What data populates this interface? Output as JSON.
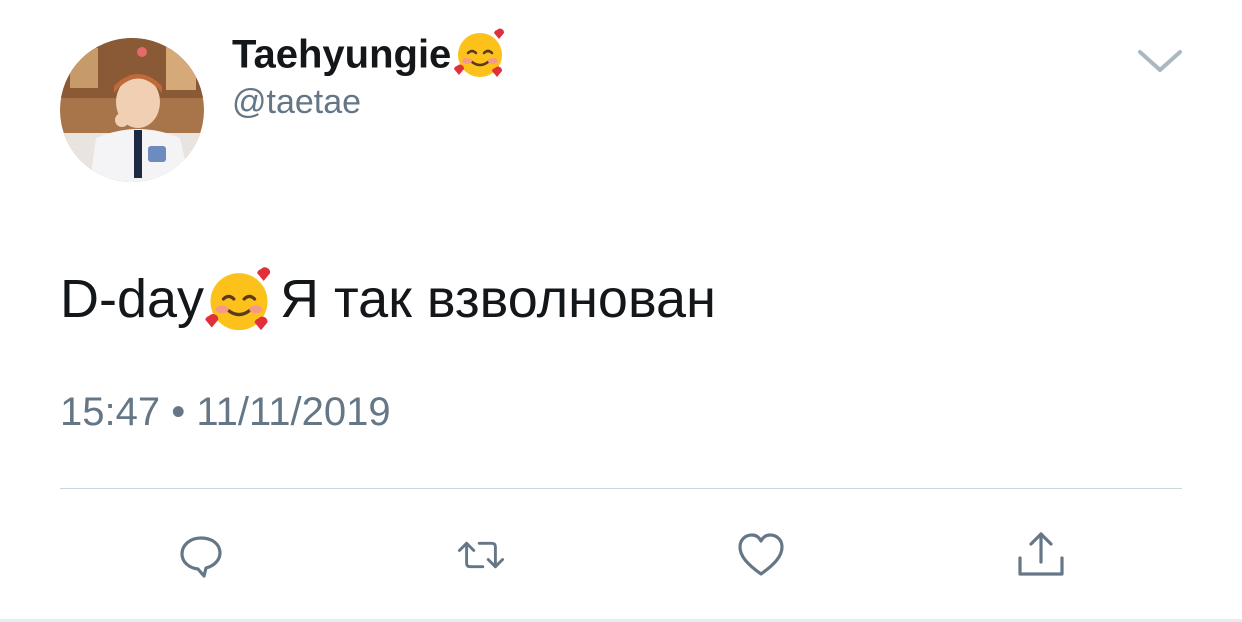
{
  "tweet": {
    "author": {
      "display_name": "Taehyungie",
      "display_name_emoji": "smiling-face-with-hearts",
      "handle": "@taetae",
      "avatar": "avatar-photo"
    },
    "menu_icon": "chevron-down-icon",
    "text": {
      "prefix": "D-day",
      "emoji": "smiling-face-with-hearts",
      "body": "Я так взволнован"
    },
    "meta": {
      "time": "15:47",
      "separator": "•",
      "date": "11/11/2019"
    },
    "actions": [
      {
        "name": "reply",
        "icon": "speech-bubble-icon"
      },
      {
        "name": "retweet",
        "icon": "retweet-icon"
      },
      {
        "name": "like",
        "icon": "heart-icon"
      },
      {
        "name": "share",
        "icon": "share-icon"
      }
    ]
  },
  "colors": {
    "text_primary": "#14171a",
    "text_secondary": "#657786",
    "icon": "#657786",
    "divider": "#ccd6dd",
    "background": "#ffffff"
  }
}
